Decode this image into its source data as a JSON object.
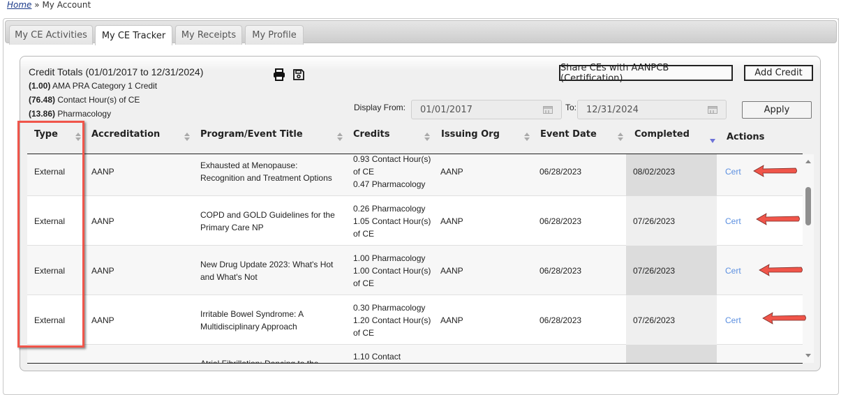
{
  "breadcrumb": {
    "home": "Home",
    "separator": "»",
    "current": "My Account"
  },
  "tabs": [
    {
      "label": "My CE Activities",
      "active": false
    },
    {
      "label": "My CE Tracker",
      "active": true
    },
    {
      "label": "My Receipts",
      "active": false
    },
    {
      "label": "My Profile",
      "active": false
    }
  ],
  "credit_totals": {
    "title": "Credit Totals (01/01/2017 to 12/31/2024)",
    "lines": [
      {
        "amount": "(1.00)",
        "label": "AMA PRA Category 1 Credit"
      },
      {
        "amount": "(76.48)",
        "label": "Contact Hour(s) of CE"
      },
      {
        "amount": "(13.86)",
        "label": "Pharmacology"
      }
    ]
  },
  "toolbar": {
    "print_icon": "print-icon",
    "save_icon": "save-icon",
    "share_label": "Share CEs with AANPCB (Certification)",
    "add_credit_label": "Add Credit"
  },
  "filter": {
    "from_label": "Display From:",
    "from_value": "01/01/2017",
    "to_label": "To:",
    "to_value": "12/31/2024",
    "apply_label": "Apply"
  },
  "table": {
    "columns": [
      "Type",
      "Accreditation",
      "Program/Event Title",
      "Credits",
      "Issuing Org",
      "Event Date",
      "Completed",
      "Actions"
    ],
    "sorted_column": "Completed",
    "sort_direction": "descending",
    "rows": [
      {
        "type": "External",
        "accreditation": "AANP",
        "title": "Exhausted at Menopause: Recognition and Treatment Options",
        "credits": [
          "0.93 Contact Hour(s) of CE",
          "0.47 Pharmacology"
        ],
        "issuing_org": "AANP",
        "event_date": "06/28/2023",
        "completed": "08/02/2023",
        "action": "Cert"
      },
      {
        "type": "External",
        "accreditation": "AANP",
        "title": "COPD and GOLD Guidelines for the Primary Care NP",
        "credits": [
          "0.26 Pharmacology",
          "1.05 Contact Hour(s) of CE"
        ],
        "issuing_org": "AANP",
        "event_date": "06/28/2023",
        "completed": "07/26/2023",
        "action": "Cert"
      },
      {
        "type": "External",
        "accreditation": "AANP",
        "title": "New Drug Update 2023: What's Hot and What's Not",
        "credits": [
          "1.00 Pharmacology",
          "1.00 Contact Hour(s) of CE"
        ],
        "issuing_org": "AANP",
        "event_date": "06/28/2023",
        "completed": "07/26/2023",
        "action": "Cert"
      },
      {
        "type": "External",
        "accreditation": "AANP",
        "title": "Irritable Bowel Syndrome: A Multidisciplinary Approach",
        "credits": [
          "0.30 Pharmacology",
          "1.20 Contact Hour(s) of CE"
        ],
        "issuing_org": "AANP",
        "event_date": "06/28/2023",
        "completed": "07/26/2023",
        "action": "Cert"
      },
      {
        "type": "",
        "accreditation": "",
        "title": "Atrial Fibrillation: Dancing to the",
        "credits": [
          "1.10 Contact"
        ],
        "issuing_org": "",
        "event_date": "",
        "completed": "",
        "action": ""
      }
    ]
  },
  "annotations": {
    "highlight_color": "#f0554a",
    "highlighted_column": "Type",
    "arrows_point_to": "Cert"
  }
}
